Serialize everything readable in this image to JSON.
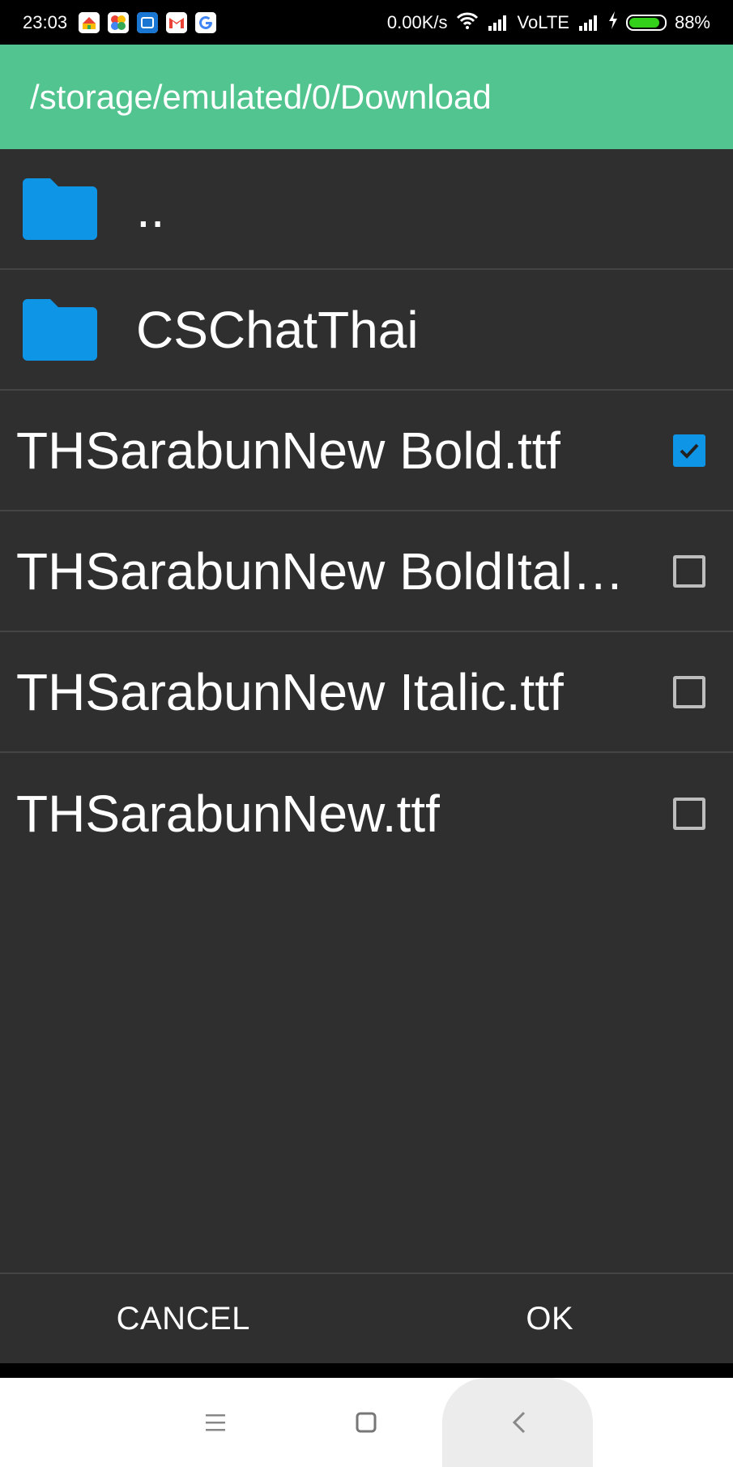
{
  "status_bar": {
    "time": "23:03",
    "notification_icons": [
      "home-icon",
      "photos-icon",
      "app-icon",
      "gmail-icon",
      "google-icon"
    ],
    "net_speed": "0.00K/s",
    "network_label": "VoLTE",
    "battery_percent": "88%",
    "battery_level": 0.88
  },
  "header": {
    "path": "/storage/emulated/0/Download"
  },
  "list": {
    "folders": [
      {
        "label": ".."
      },
      {
        "label": "CSChatThai"
      }
    ],
    "files": [
      {
        "label": "THSarabunNew Bold.ttf",
        "checked": true
      },
      {
        "label": "THSarabunNew BoldItal…",
        "checked": false
      },
      {
        "label": "THSarabunNew Italic.ttf",
        "checked": false
      },
      {
        "label": "THSarabunNew.ttf",
        "checked": false
      }
    ]
  },
  "dialog_buttons": {
    "cancel": "CANCEL",
    "ok": "OK"
  },
  "colors": {
    "header_bg": "#52c48f",
    "list_bg": "#2f2f2f",
    "accent": "#0f95e6",
    "folder": "#0f95e6"
  }
}
